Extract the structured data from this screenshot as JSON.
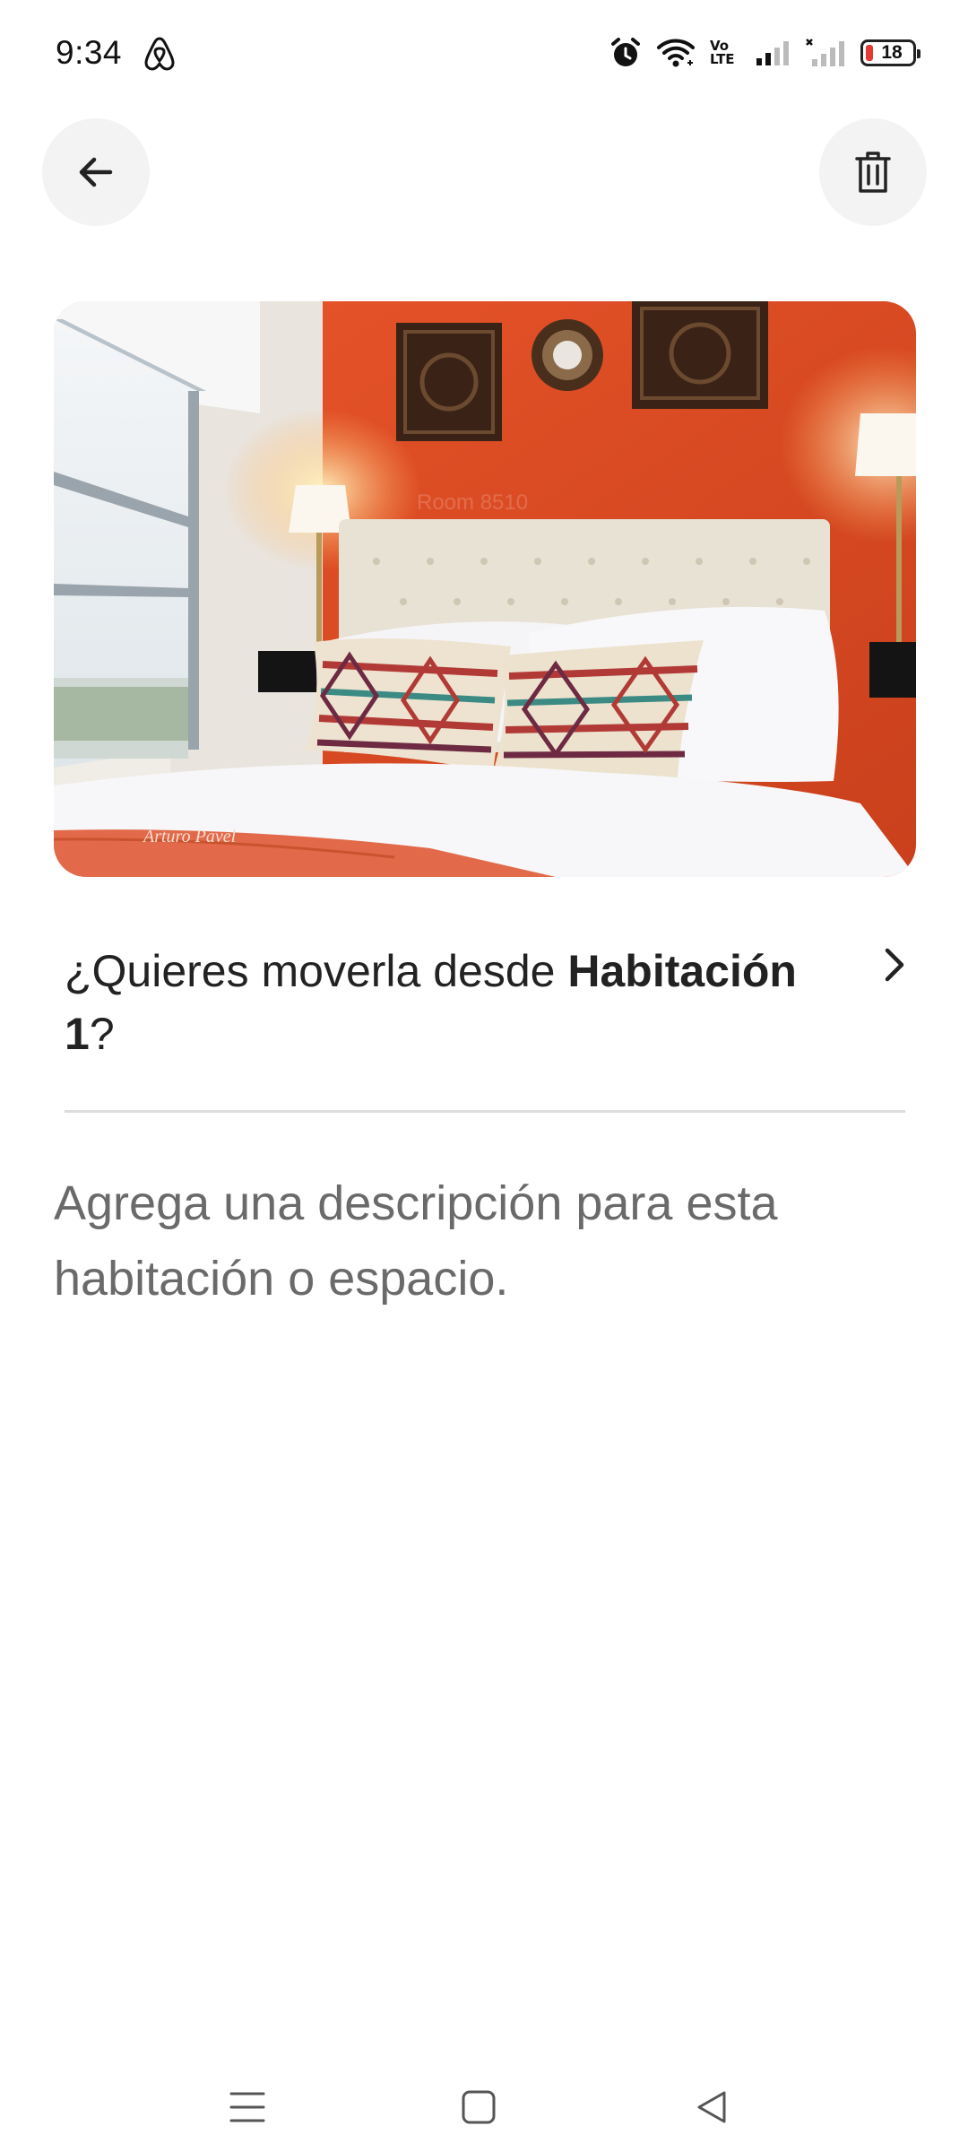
{
  "status_bar": {
    "time": "9:34",
    "battery": "18",
    "volte_top": "Vo",
    "volte_bottom": "LTE",
    "icons": [
      "airbnb-icon",
      "alarm-icon",
      "wifi-icon",
      "volte-icon",
      "signal-icon",
      "signal-no-service-icon",
      "battery-icon"
    ]
  },
  "header": {
    "back_icon": "arrow-left-icon",
    "delete_icon": "trash-icon"
  },
  "photo": {
    "watermark_signature": "Arturo Pavel",
    "watermark_room": "Room 8510"
  },
  "move_row": {
    "prefix": "¿Quieres moverla desde ",
    "room": "Habitación 1",
    "suffix": "?",
    "chevron_icon": "chevron-right-icon"
  },
  "description": {
    "placeholder": "Agrega una descripción para esta habitación o espacio."
  },
  "nav_bar": {
    "icons": [
      "menu-icon",
      "home-square-icon",
      "back-triangle-icon"
    ]
  },
  "colors": {
    "accent_wall": "#e85a2a",
    "button_bg": "#f3f3f3",
    "text_primary": "#222222",
    "text_secondary": "#6a6a6a",
    "divider": "#dddddd",
    "battery_low": "#e53935"
  }
}
